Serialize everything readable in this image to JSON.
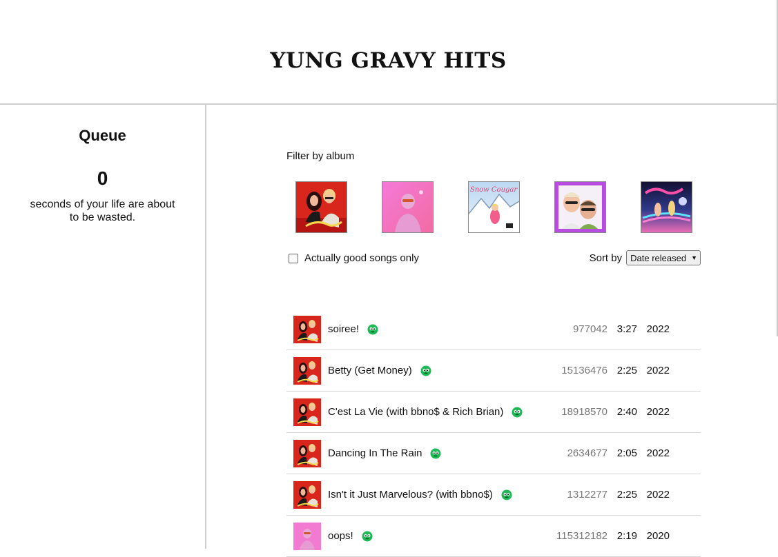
{
  "header": {
    "title": "YUNG GRAVY HITS"
  },
  "queue": {
    "title": "Queue",
    "count": "0",
    "caption": "seconds of your life are about to be wasted."
  },
  "filters": {
    "label": "Filter by album",
    "albums": [
      {
        "name": "marvelous-album-cover"
      },
      {
        "name": "gasanova-album-cover"
      },
      {
        "name": "snow-cougar-album-cover",
        "cover_text": "Snow Cougar"
      },
      {
        "name": "baby-gravy-album-cover"
      },
      {
        "name": "sensational-album-cover"
      }
    ],
    "good_only_label": "Actually good songs only",
    "sort_label": "Sort by",
    "sort_value": "Date released"
  },
  "songs": [
    {
      "title": "soiree!",
      "plays": "977042",
      "duration": "3:27",
      "year": "2022"
    },
    {
      "title": "Betty (Get Money)",
      "plays": "15136476",
      "duration": "2:25",
      "year": "2022"
    },
    {
      "title": "C'est La Vie (with bbno$ & Rich Brian)",
      "plays": "18918570",
      "duration": "2:40",
      "year": "2022"
    },
    {
      "title": "Dancing In The Rain",
      "plays": "2634677",
      "duration": "2:05",
      "year": "2022"
    },
    {
      "title": "Isn't it Just Marvelous? (with bbno$)",
      "plays": "1312277",
      "duration": "2:25",
      "year": "2022"
    },
    {
      "title": "oops!",
      "plays": "115312182",
      "duration": "2:19",
      "year": "2020"
    }
  ],
  "colors": {
    "gremlin": "#1db954",
    "border": "#cfcfcf",
    "plays": "#777777"
  }
}
